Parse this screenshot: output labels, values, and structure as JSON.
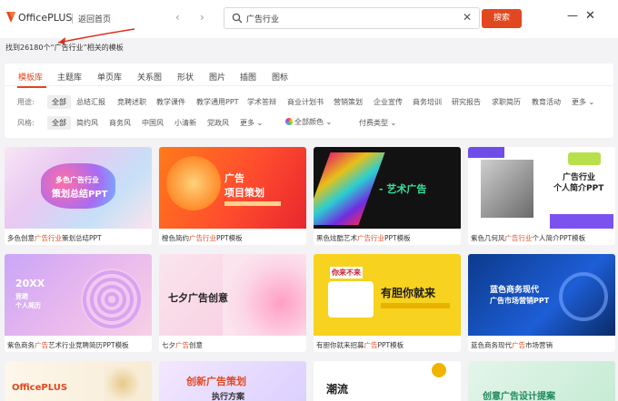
{
  "app": {
    "name": "OfficePLUS",
    "back_home": "返回首页"
  },
  "search": {
    "query": "广告行业",
    "button": "搜索"
  },
  "result": {
    "prefix": "找到26180个“",
    "keyword": "广告行业",
    "suffix": "”相关的模板"
  },
  "type_tabs": [
    "模板库",
    "主题库",
    "单页库",
    "关系图",
    "形状",
    "图片",
    "插图",
    "图标"
  ],
  "purpose": {
    "label": "用途:",
    "items": [
      "全部",
      "总结汇报",
      "竞聘述职",
      "教学课件",
      "教学通用PPT",
      "学术答辩",
      "商业计划书",
      "营销策划",
      "企业宣传",
      "商务培训",
      "研究报告",
      "求职简历",
      "教育活动",
      "更多"
    ]
  },
  "style": {
    "label": "风格:",
    "items": [
      "全部",
      "简约风",
      "商务风",
      "中国风",
      "小清新",
      "党政风",
      "更多"
    ],
    "color_filter": "全部颜色",
    "pay_filter": "付费类型"
  },
  "cards": [
    {
      "pre": "多色创意",
      "hl": "广告行业",
      "post": "策划总结PPT",
      "thumb_title": "多色广告行业",
      "thumb_sub": "策划总结PPT"
    },
    {
      "pre": "橙色简约",
      "hl": "广告行业",
      "post": "PPT模板",
      "thumb_title": "广告",
      "thumb_sub": "项目策划"
    },
    {
      "pre": "黑色炫酷艺术",
      "hl": "广告行业",
      "post": "PPT模板",
      "thumb_title": "- 艺术广告"
    },
    {
      "pre": "紫色几何风",
      "hl": "广告行业",
      "post": "个人简介PPT模板",
      "thumb_title": "广告行业",
      "thumb_sub": "个人简介PPT"
    },
    {
      "pre": "紫色商务",
      "hl": "广告",
      "post": "艺术行业竞聘简历PPT模板",
      "thumb_title": "20XX",
      "thumb_sub": "竞聘",
      "thumb_sub2": "个人简历"
    },
    {
      "pre": "七夕",
      "hl": "广告",
      "post": "创意",
      "thumb_title": "七夕广告创意"
    },
    {
      "pre": "有胆你就来招募",
      "hl": "广告",
      "post": "PPT模板",
      "thumb_title": "有胆你就来",
      "thumb_badge": "你来不来"
    },
    {
      "pre": "蓝色商务现代",
      "hl": "广告",
      "post": "市场营销",
      "thumb_title": "蓝色商务现代",
      "thumb_sub": "广告市场营销PPT"
    },
    {
      "thumb_title": "OfficePLUS"
    },
    {
      "thumb_title": "创新广告策划",
      "thumb_sub": "执行方案"
    },
    {
      "thumb_title": "潮流"
    },
    {
      "thumb_title": "创意广告设计提案"
    }
  ]
}
